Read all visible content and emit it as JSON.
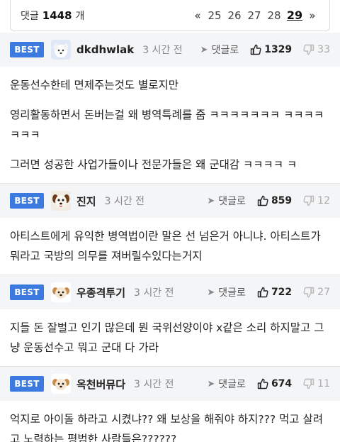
{
  "pager": {
    "count_label": "댓글",
    "count_value": "1448",
    "count_unit": "개",
    "prev_icon": "«",
    "next_icon": "»",
    "pages": [
      "25",
      "26",
      "27",
      "28",
      "29"
    ],
    "current_page": "29"
  },
  "comments": [
    {
      "badge": "BEST",
      "avatar_icon": "white-dog-avatar-icon",
      "name": "dkdhwlak",
      "time": "3 시간 전",
      "reply_label": "댓글로",
      "likes": "1329",
      "dislikes": "33",
      "paragraphs": [
        "운동선수한테 면제주는것도 별로지만",
        "영리활동하면서 돈버는걸 왜 병역특례를 줌 ㅋㅋㅋㅋㅋㅋㅋ ㅋㅋㅋㅋㅋㅋㅋ",
        "그러면 성공한 사업가들이나 전문가들은 왜 군대감 ㅋㅋㅋㅋ ㅋ"
      ]
    },
    {
      "badge": "BEST",
      "avatar_icon": "dog-face-avatar-icon",
      "name": "진지",
      "time": "3 시간 전",
      "reply_label": "댓글로",
      "likes": "859",
      "dislikes": "12",
      "paragraphs": [
        "아티스트에게 유익한 병역법이란 말은 선 넘은거 아니냐. 아티스트가 뭐라고 국방의 의무를 져버릴수있다는거지"
      ]
    },
    {
      "badge": "BEST",
      "avatar_icon": "puppy-avatar-icon",
      "name": "우종격투기",
      "time": "3 시간 전",
      "reply_label": "댓글로",
      "likes": "722",
      "dislikes": "27",
      "paragraphs": [
        "지들 돈 잘벌고 인기 많은데 뭔 국위선양이야 x같은 소리 하지말고 그냥 운동선수고 뭐고 군대 다 가라"
      ]
    },
    {
      "badge": "BEST",
      "avatar_icon": "puppy-avatar-icon",
      "name": "옥천버뮤다",
      "time": "3 시간 전",
      "reply_label": "댓글로",
      "likes": "674",
      "dislikes": "11",
      "paragraphs": [
        "억지로 아이돌 하라고 시켰냐?? 왜 보상을 해줘야 하지??? 먹고 살려고 노력하는 평범한 사람들은??????"
      ]
    }
  ],
  "colors": {
    "best_badge": "#3d7ae0",
    "header_bg": "#f4f5f7"
  }
}
